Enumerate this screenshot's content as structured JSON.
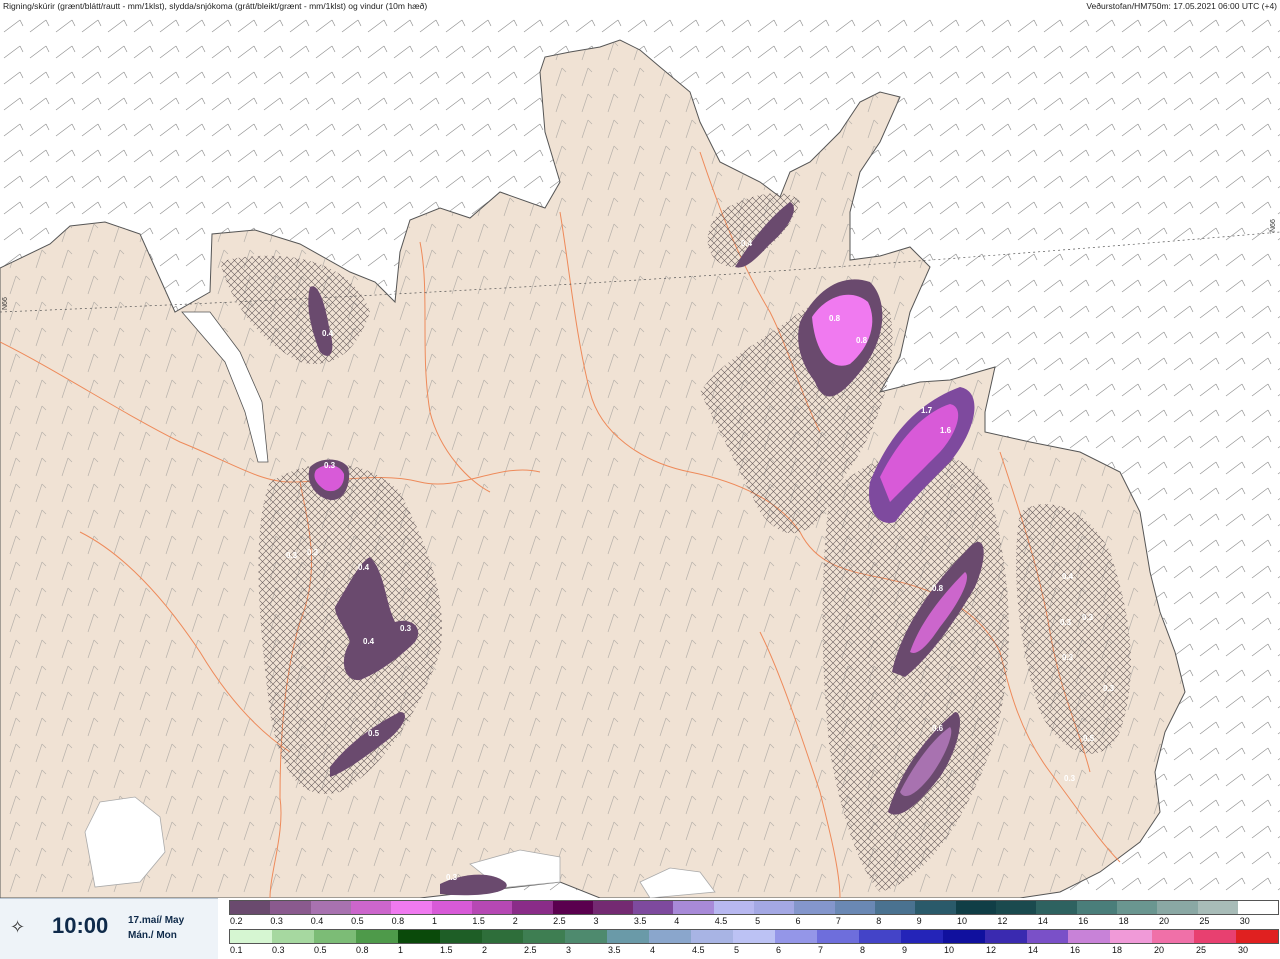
{
  "header": {
    "left_caption": "Rigning/skúrir (grænt/blátt/rautt - mm/1klst), slydda/snjókoma (grátt/bleikt/grænt - mm/1klst) og vindur (10m hæð)",
    "right_caption": "Veðurstofan/HM750m: 17.05.2021 06:00 UTC (+4)"
  },
  "map": {
    "land_color": "#f0e2d4",
    "sea_color": "#ffffff",
    "road_color": "#ee8a5a",
    "latitude_label": "N66",
    "precip_labels": [
      "0.4",
      "0.8",
      "0.8",
      "0.5",
      "0.4",
      "0.3",
      "1.7",
      "1.6",
      "0.3",
      "0.3",
      "0.4",
      "0.8",
      "0.4",
      "0.3",
      "0.3",
      "0.4",
      "0.3",
      "0.3",
      "0.6",
      "0.3",
      "0.5",
      "0.3",
      "0.3"
    ]
  },
  "timebox": {
    "icon": "sun-cloud-icon",
    "time": "10:00",
    "date_line1": "17.maí/ May",
    "date_line2": "Mán./ Mon"
  },
  "legend": {
    "snow": {
      "labels": [
        "0.2",
        "0.3",
        "0.4",
        "0.5",
        "0.8",
        "1",
        "1.5",
        "2",
        "2.5",
        "3",
        "3.5",
        "4",
        "4.5",
        "5",
        "6",
        "7",
        "8",
        "9",
        "10",
        "12",
        "14",
        "16",
        "18",
        "20",
        "25",
        "30"
      ],
      "colors": [
        "#6a4a6e",
        "#8a5a8e",
        "#a872b0",
        "#cc66cc",
        "#f07af0",
        "#d85ad8",
        "#b648b4",
        "#8a2c88",
        "#5a004e",
        "#742a72",
        "#7e4a9e",
        "#a88ad8",
        "#b8b8f0",
        "#a4a8e4",
        "#8496cc",
        "#6a88b4",
        "#4a7290",
        "#2a5a6a",
        "#103e46",
        "#1a4a4e",
        "#2e6260",
        "#4a7e7a",
        "#6a9690",
        "#8aa8a4",
        "#a8bcb8",
        "#ffffff"
      ]
    },
    "rain": {
      "labels": [
        "0.1",
        "0.3",
        "0.5",
        "0.8",
        "1",
        "1.5",
        "2",
        "2.5",
        "3",
        "3.5",
        "4",
        "4.5",
        "5",
        "6",
        "7",
        "8",
        "9",
        "10",
        "12",
        "14",
        "16",
        "18",
        "20",
        "25",
        "30"
      ],
      "colors": [
        "#d6f6d2",
        "#a6d8a0",
        "#7cbc76",
        "#4e9a4a",
        "#0a4a0a",
        "#1e5e26",
        "#2e6e3a",
        "#3e7e52",
        "#4e8a6e",
        "#6a9aa8",
        "#8aa6cc",
        "#a8b4e4",
        "#bcc2f4",
        "#9496e8",
        "#6e6edc",
        "#4444c8",
        "#2424b8",
        "#10109e",
        "#3a2ab0",
        "#7a50c8",
        "#c882d8",
        "#f09ad8",
        "#f070a8",
        "#e84070",
        "#e02020"
      ]
    }
  }
}
